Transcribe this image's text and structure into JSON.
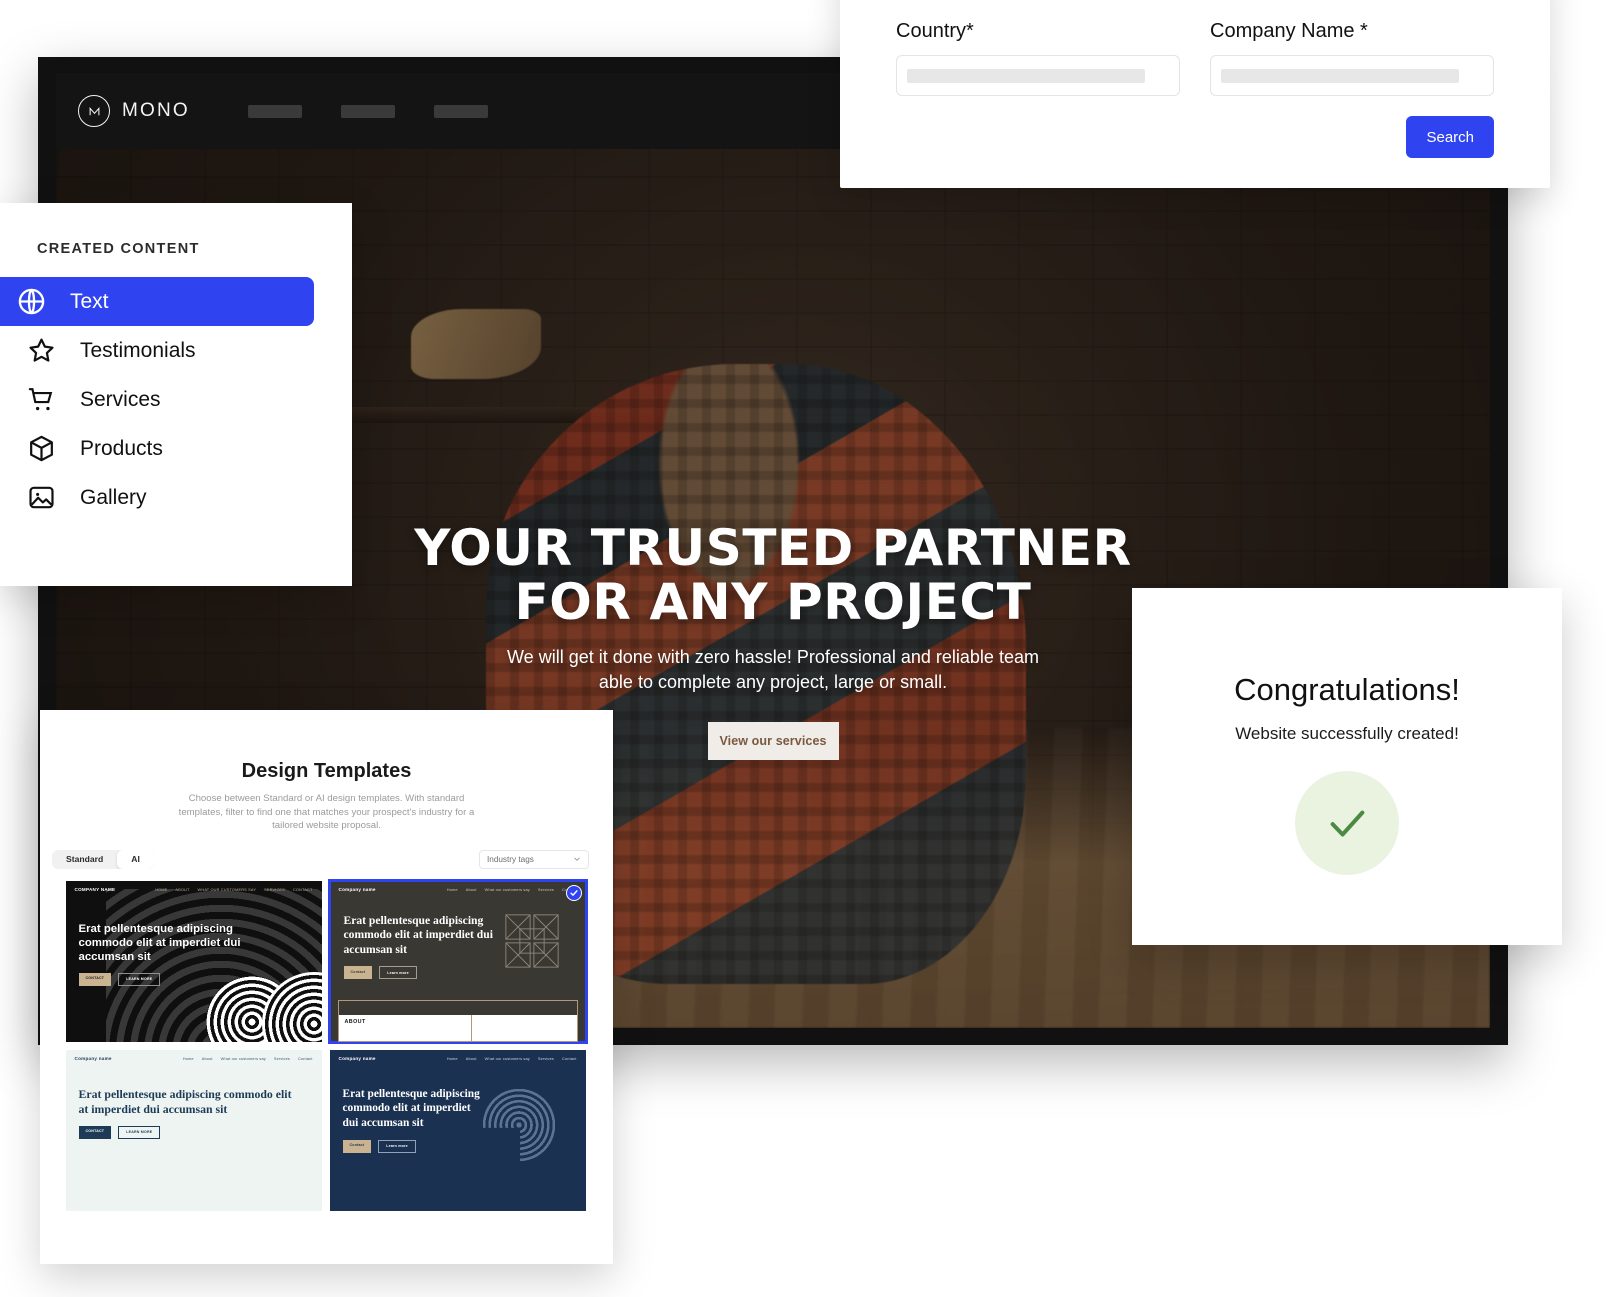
{
  "site_preview": {
    "brand_mark": "mono-logo-icon",
    "brand_name": "MONO",
    "nav_placeholder_count": 3,
    "hero": {
      "title_line1": "YOUR TRUSTED PARTNER",
      "title_line2": "FOR ANY PROJECT",
      "subtitle": "We will get it done with zero hassle! Professional and reliable team able to complete any project, large or small.",
      "cta_label": "View our services",
      "cta_text_color": "#7a5842",
      "cta_bg_color": "#f0ece7"
    }
  },
  "search_card": {
    "country_label": "Country*",
    "country_value": "",
    "country_placeholder": "",
    "company_label": "Company Name *",
    "company_value": "",
    "company_placeholder": "",
    "search_label": "Search",
    "accent_color": "#2f44f0"
  },
  "created_content": {
    "title": "CREATED CONTENT",
    "active_index": 0,
    "accent_color": "#2f44f0",
    "items": [
      {
        "label": "Text",
        "icon": "globe-icon"
      },
      {
        "label": "Testimonials",
        "icon": "star-icon"
      },
      {
        "label": "Services",
        "icon": "cart-icon"
      },
      {
        "label": "Products",
        "icon": "box-icon"
      },
      {
        "label": "Gallery",
        "icon": "image-icon"
      }
    ]
  },
  "design_templates": {
    "title": "Design Templates",
    "description": "Choose between Standard or AI design templates. With standard templates, filter to find one that matches your prospect's industry for a tailored website proposal.",
    "segment": {
      "options": [
        "Standard",
        "AI"
      ],
      "selected": "AI"
    },
    "tags_select": {
      "label": "Industry tags",
      "icon": "chevron-down-icon"
    },
    "cards": [
      {
        "theme": "dark-sans",
        "brand": "COMPANY NAME",
        "links": [
          "HOME",
          "ABOUT",
          "WHAT OUR CUSTOMERS SAY",
          "SERVICES",
          "CONTACT"
        ],
        "heading": "Erat pellentesque adipiscing commodo elit at imperdiet dui accumsan sit",
        "buttons": [
          "CONTACT",
          "LEARN MORE"
        ],
        "selected": false
      },
      {
        "theme": "warm-gray-serif",
        "brand": "Company name",
        "links": [
          "Home",
          "About",
          "What our customers say",
          "Services",
          "Contact"
        ],
        "heading": "Erat pellentesque adipiscing commodo elit at imperdiet dui accumsan sit",
        "buttons": [
          "Contact",
          "Learn more"
        ],
        "about_label": "ABOUT",
        "selected": true,
        "badge_icon": "check-circle-icon"
      },
      {
        "theme": "light-mint-serif",
        "brand": "Company name",
        "links": [
          "Home",
          "About",
          "What our customers say",
          "Services",
          "Contact"
        ],
        "heading": "Erat pellentesque adipiscing commodo elit at imperdiet dui accumsan sit",
        "buttons": [
          "CONTACT",
          "LEARN MORE"
        ],
        "selected": false
      },
      {
        "theme": "navy-serif",
        "brand": "Company name",
        "links": [
          "Home",
          "About",
          "What our customers say",
          "Services",
          "Contact"
        ],
        "heading": "Erat pellentesque adipiscing commodo elit at imperdiet dui accumsan sit",
        "buttons": [
          "Contact",
          "Learn more"
        ],
        "selected": false
      }
    ]
  },
  "congratulations": {
    "title": "Congratulations!",
    "subtitle": "Website successfully created!",
    "icon": "check-icon",
    "icon_color": "#4b8a43",
    "circle_color": "#e9f3e0"
  }
}
